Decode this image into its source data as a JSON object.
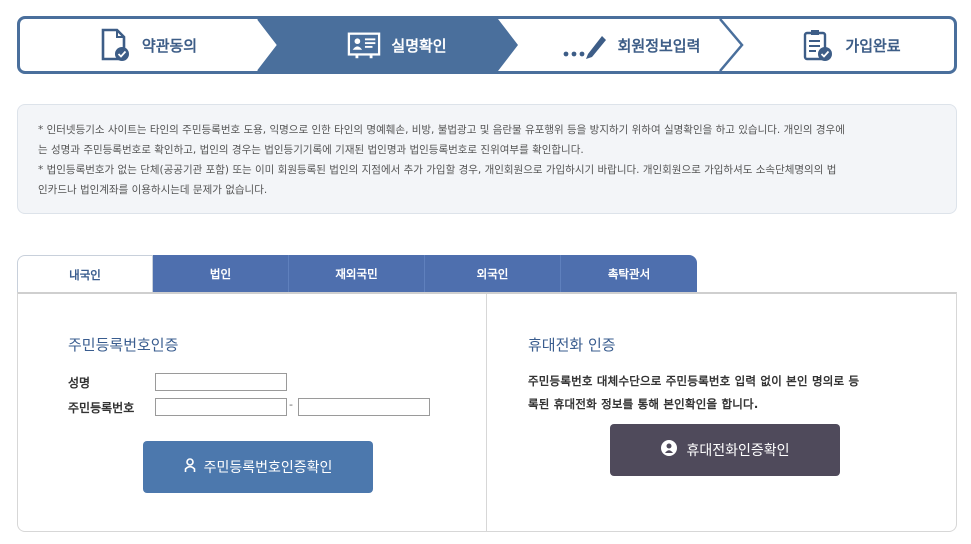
{
  "steps": [
    {
      "label": "약관동의",
      "icon": "document-check-icon"
    },
    {
      "label": "실명확인",
      "icon": "id-card-icon"
    },
    {
      "label": "회원정보입력",
      "icon": "pencil-icon"
    },
    {
      "label": "가입완료",
      "icon": "clipboard-check-icon"
    }
  ],
  "colors": {
    "step_active": "#4a6f9c",
    "tab_bg": "#4e6fae",
    "btn_blue": "#4c78ad",
    "btn_dark": "#4f4a5b"
  },
  "notice": {
    "line1": "* 인터넷등기소 사이트는 타인의 주민등록번호 도용, 익명으로 인한 타인의 명예훼손, 비방, 불법광고 및 음란물 유포행위 등을 방지하기 위하여 실명확인을 하고 있습니다. 개인의 경우에",
    "line2": "는 성명과 주민등록번호로 확인하고, 법인의 경우는 법인등기기록에 기재된 법인명과 법인등록번호로 진위여부를 확인합니다.",
    "line3": "* 법인등록번호가 없는 단체(공공기관 포함) 또는 이미 회원등록된 법인의 지점에서 추가 가입할 경우, 개인회원으로 가입하시기 바랍니다. 개인회원으로 가입하셔도 소속단체명의의 법",
    "line4": "인카드나 법인계좌를 이용하시는데 문제가 없습니다."
  },
  "tabs": [
    "내국인",
    "법인",
    "재외국민",
    "외국인",
    "촉탁관서"
  ],
  "left": {
    "title": "주민등록번호인증",
    "name_label": "성명",
    "rrn_label": "주민등록번호",
    "name_value": "",
    "rrn1_value": "",
    "rrn2_value": "",
    "dash": "-",
    "button": "주민등록번호인증확인"
  },
  "right": {
    "title": "휴대전화 인증",
    "desc1": "주민등록번호 대체수단으로 주민등록번호 입력 없이 본인 명의로 등",
    "desc2": "록된 휴대전화 정보를 통해 본인확인을 합니다.",
    "button": "휴대전화인증확인"
  }
}
